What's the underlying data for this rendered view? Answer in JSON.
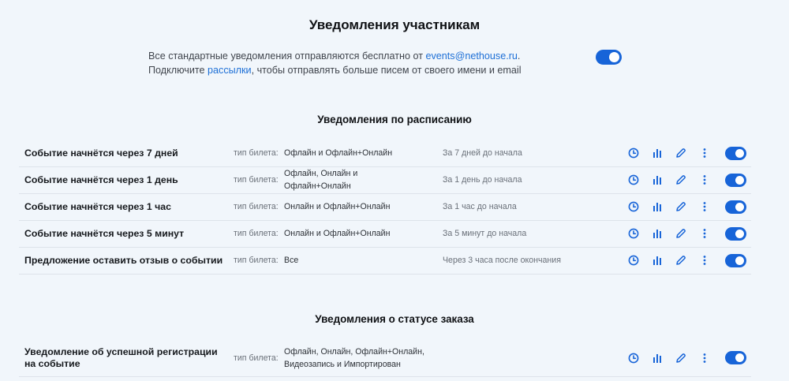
{
  "page_title": "Уведомления участникам",
  "intro": {
    "text_1": "Все стандартные уведомления отправляются бесплатно от ",
    "email_link": "events@nethouse.ru",
    "text_2": ". Подключите ",
    "mailing_link": "рассылки",
    "text_3": ", чтобы отправлять больше писем от своего имени и email",
    "toggle_on": true
  },
  "sections": [
    {
      "title": "Уведомления по расписанию",
      "rows": [
        {
          "name": "Событие начнётся через 7 дней",
          "ticket_label": "тип билета:",
          "ticket_types": "Офлайн и Офлайн+Онлайн",
          "timing": "За 7 дней до начала",
          "enabled": true
        },
        {
          "name": "Событие начнётся через 1 день",
          "ticket_label": "тип билета:",
          "ticket_types": "Офлайн, Онлайн и Офлайн+Онлайн",
          "timing": "За 1 день до начала",
          "enabled": true
        },
        {
          "name": "Событие начнётся через 1 час",
          "ticket_label": "тип билета:",
          "ticket_types": "Онлайн и Офлайн+Онлайн",
          "timing": "За 1 час до начала",
          "enabled": true
        },
        {
          "name": "Событие начнётся через 5 минут",
          "ticket_label": "тип билета:",
          "ticket_types": "Онлайн и Офлайн+Онлайн",
          "timing": "За 5 минут до начала",
          "enabled": true
        },
        {
          "name": "Предложение оставить отзыв о событии",
          "ticket_label": "тип билета:",
          "ticket_types": "Все",
          "timing": "Через 3 часа после окончания",
          "enabled": true
        }
      ]
    },
    {
      "title": "Уведомления о статусе заказа",
      "rows": [
        {
          "name": "Уведомление об успешной регистрации на событие",
          "ticket_label": "тип билета:",
          "ticket_types": "Офлайн, Онлайн, Офлайн+Онлайн, Видеозапись и Импортирован",
          "timing": "",
          "enabled": true
        }
      ]
    }
  ],
  "icons": [
    "clock-icon",
    "bar-chart-icon",
    "pencil-icon",
    "more-vertical-icon"
  ],
  "colors": {
    "accent": "#1764d8",
    "link": "#1d6fd6",
    "background": "#f1f6fb"
  }
}
